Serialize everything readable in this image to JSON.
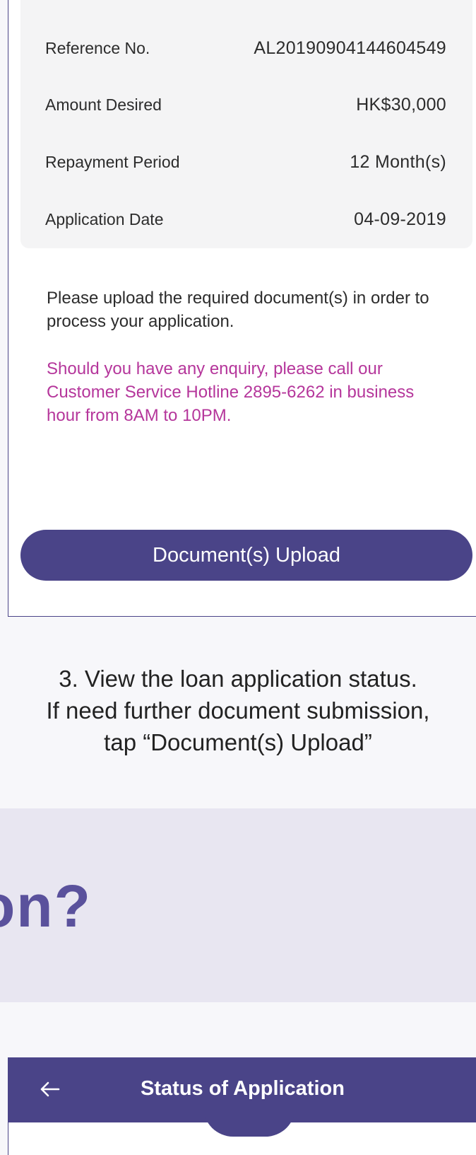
{
  "application_details": {
    "rows": [
      {
        "label": "Reference No.",
        "value": "AL20190904144604549"
      },
      {
        "label": "Amount Desired",
        "value": "HK$30,000"
      },
      {
        "label": "Repayment Period",
        "value": "12 Month(s)"
      },
      {
        "label": "Application Date",
        "value": "04-09-2019"
      }
    ]
  },
  "notice_text": "Please upload the required document(s) in order to process your application.",
  "enquiry_text": "Should you have any enquiry, please call our Customer Service Hotline 2895-6262 in business hour from 8AM to 10PM.",
  "upload_button_label": "Document(s) Upload",
  "caption": {
    "line1": "3. View the loan application status.",
    "line2": "If need further document submission,",
    "line3": "tap “Document(s) Upload”"
  },
  "banner_heading": "on?",
  "status_screen": {
    "title": "Status of Application",
    "back_icon": "arrow-left-icon"
  },
  "colors": {
    "brand_purple": "#4a4488",
    "enquiry_pink": "#b5369b",
    "banner_bg": "#e8e6f1",
    "heading_purple": "#5a519c"
  }
}
